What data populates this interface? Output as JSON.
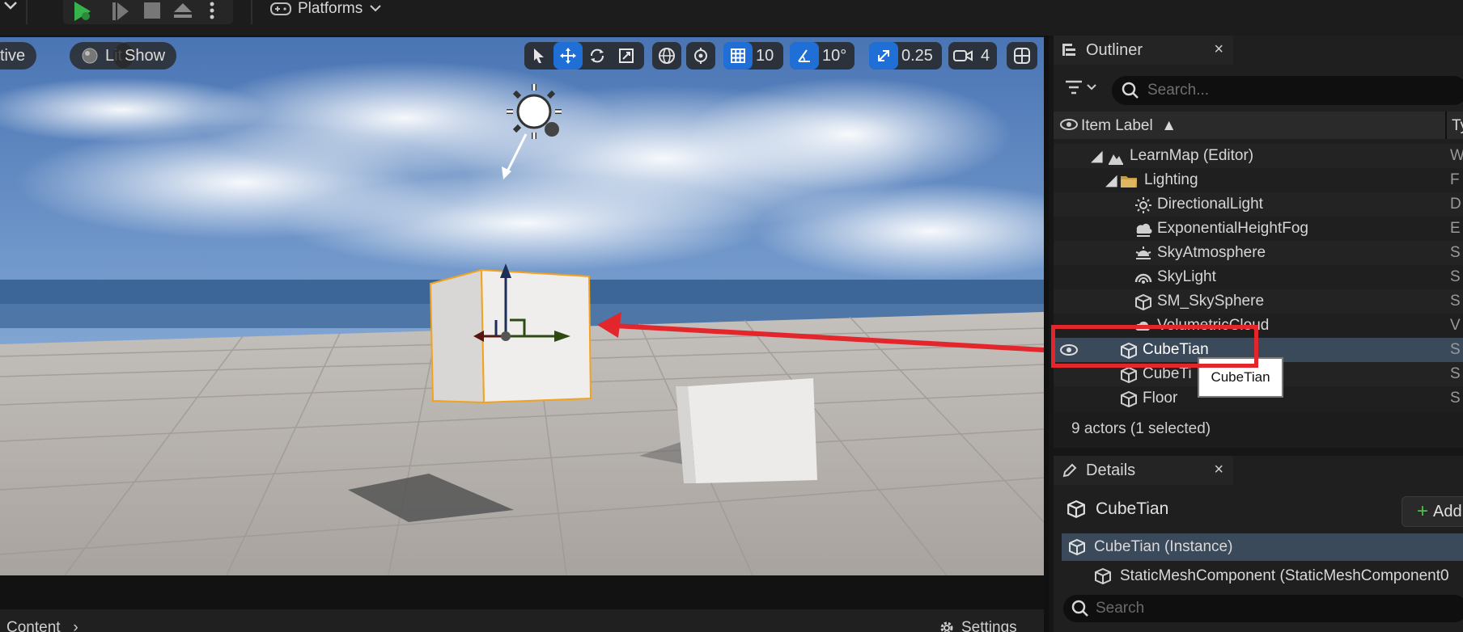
{
  "toolbar": {
    "platforms_label": "Platforms"
  },
  "viewport": {
    "perspective_label": "tive",
    "lit_label": "Lit",
    "show_label": "Show",
    "grid_snap_value": "10",
    "angle_snap_value": "10°",
    "scale_snap_value": "0.25",
    "camera_speed_value": "4"
  },
  "content_bar": {
    "content_label": "Content",
    "settings_label": "Settings"
  },
  "outliner": {
    "tab_label": "Outliner",
    "close_label": "×",
    "search_placeholder": "Search...",
    "column_item_label": "Item Label",
    "column_type_label": "Ty",
    "rows": [
      {
        "label": "LearnMap (Editor)",
        "type": "W"
      },
      {
        "label": "Lighting",
        "type": "F"
      },
      {
        "label": "DirectionalLight",
        "type": "D"
      },
      {
        "label": "ExponentialHeightFog",
        "type": "E"
      },
      {
        "label": "SkyAtmosphere",
        "type": "S"
      },
      {
        "label": "SkyLight",
        "type": "S"
      },
      {
        "label": "SM_SkySphere",
        "type": "S"
      },
      {
        "label": "VolumetricCloud",
        "type": "V"
      },
      {
        "label": "CubeTian",
        "type": "S"
      },
      {
        "label": "CubeTi",
        "type": "S"
      },
      {
        "label": "Floor",
        "type": "S"
      }
    ],
    "tooltip": "CubeTian",
    "status": "9 actors (1 selected)"
  },
  "details": {
    "tab_label": "Details",
    "close_label": "×",
    "actor_name": "CubeTian",
    "add_label": "Add",
    "instance_label": "CubeTian (Instance)",
    "component_label": "StaticMeshComponent (StaticMeshComponent0",
    "search_placeholder": "Search"
  }
}
